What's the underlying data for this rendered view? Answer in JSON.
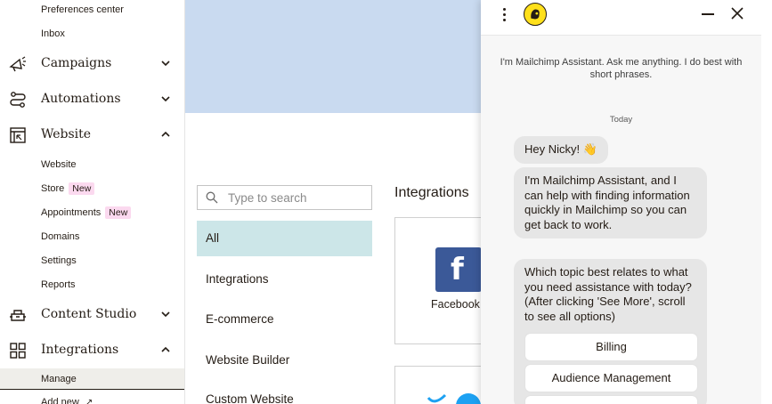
{
  "sidebar": {
    "top_items": [
      "Preferences center",
      "Inbox"
    ],
    "sections": [
      {
        "label": "Campaigns",
        "icon": "megaphone-icon",
        "expanded": false
      },
      {
        "label": "Automations",
        "icon": "flow-icon",
        "expanded": false
      },
      {
        "label": "Website",
        "icon": "website-icon",
        "expanded": true
      },
      {
        "label": "Content Studio",
        "icon": "content-studio-icon",
        "expanded": false
      },
      {
        "label": "Integrations",
        "icon": "grid-icon",
        "expanded": true
      }
    ],
    "website_items": [
      {
        "label": "Website"
      },
      {
        "label": "Store",
        "badge": "New"
      },
      {
        "label": "Appointments",
        "badge": "New"
      },
      {
        "label": "Domains"
      },
      {
        "label": "Settings"
      },
      {
        "label": "Reports"
      }
    ],
    "integration_items": [
      {
        "label": "Manage",
        "active": true
      },
      {
        "label": "Add new",
        "external": "↗"
      }
    ]
  },
  "main": {
    "search": {
      "placeholder": "Type to search",
      "value": ""
    },
    "categories": [
      {
        "label": "All",
        "active": true
      },
      {
        "label": "Integrations"
      },
      {
        "label": "E-commerce"
      },
      {
        "label": "Website Builder"
      },
      {
        "label": "Custom Website"
      }
    ],
    "section_heading": "Integrations",
    "cards": [
      {
        "label": "Facebook",
        "icon": "facebook-icon",
        "glyph": "f"
      },
      {
        "label": "",
        "icon": "twitter-icon"
      }
    ]
  },
  "chat": {
    "intro": "I'm Mailchimp Assistant. Ask me anything. I do best with short phrases.",
    "date_label": "Today",
    "messages": [
      "Hey Nicky! 👋",
      "I'm Mailchimp Assistant, and I can help with finding information quickly in Mailchimp so you can get back to work.",
      "Which topic best relates to what you need assistance with today? (After clicking 'See More', scroll to see all options)"
    ],
    "topics": [
      "Billing",
      "Audience Management"
    ]
  },
  "colors": {
    "brand_yellow": "#ffe01b",
    "active_category": "#cce6e8",
    "hero": "#c9daf0",
    "badge": "#fbd9ef",
    "facebook": "#3b5998"
  }
}
